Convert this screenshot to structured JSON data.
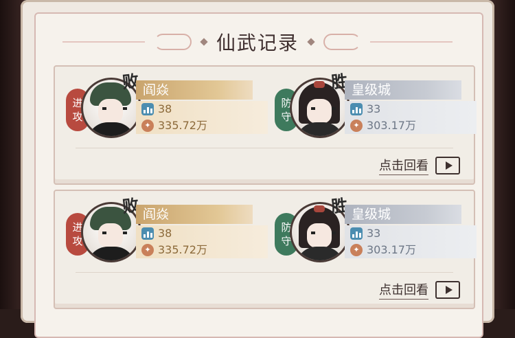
{
  "title": "仙武记录",
  "records": [
    {
      "attacker": {
        "role_label": [
          "进",
          "攻"
        ],
        "result": "败",
        "name": "阎焱",
        "level": "38",
        "power": "335.72万"
      },
      "defender": {
        "role_label": [
          "防",
          "守"
        ],
        "result": "胜",
        "name": "皇级城",
        "level": "33",
        "power": "303.17万"
      },
      "replay_label": "点击回看"
    },
    {
      "attacker": {
        "role_label": [
          "进",
          "攻"
        ],
        "result": "败",
        "name": "阎焱",
        "level": "38",
        "power": "335.72万"
      },
      "defender": {
        "role_label": [
          "防",
          "守"
        ],
        "result": "胜",
        "name": "皇级城",
        "level": "33",
        "power": "303.17万"
      },
      "replay_label": "点击回看"
    }
  ],
  "colors": {
    "attack_badge": "#b84a3f",
    "defend_badge": "#3e7a5d",
    "winner_bar": "#c9a46d",
    "loser_bar": "#aeb3be"
  },
  "icons": {
    "level": "level-bars-icon",
    "power": "power-coin-icon",
    "play": "play-icon"
  }
}
